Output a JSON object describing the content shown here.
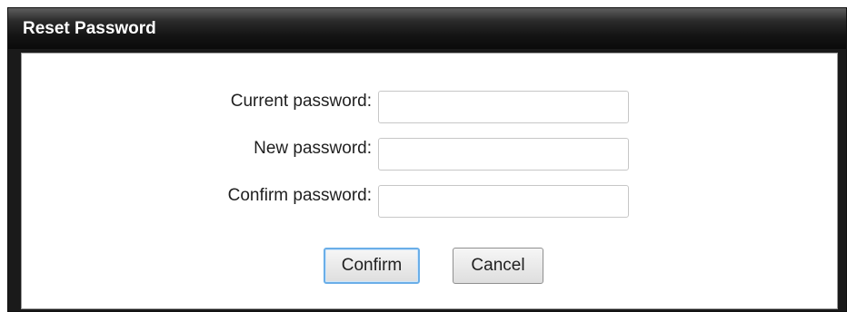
{
  "dialog": {
    "title": "Reset Password"
  },
  "form": {
    "current_password": {
      "label": "Current password:",
      "value": ""
    },
    "new_password": {
      "label": "New password:",
      "value": ""
    },
    "confirm_password": {
      "label": "Confirm password:",
      "value": ""
    }
  },
  "buttons": {
    "confirm_label": "Confirm",
    "cancel_label": "Cancel"
  },
  "colors": {
    "titlebar": "#141414",
    "title_text": "#ffffff",
    "focus_border": "#6aaee8"
  }
}
